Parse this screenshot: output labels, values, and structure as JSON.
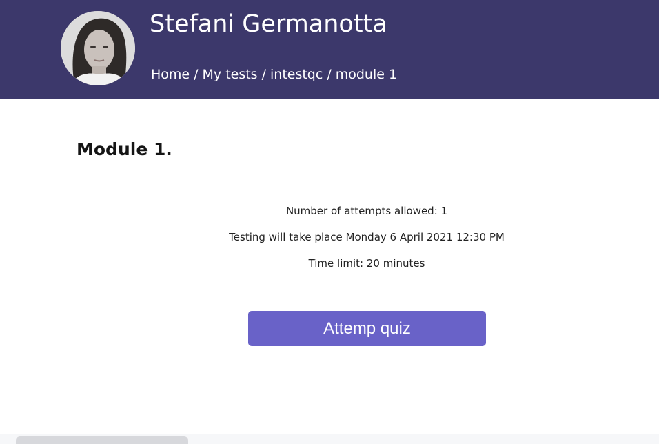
{
  "header": {
    "user_name": "Stefani Germanotta",
    "avatar_icon": "user-avatar-photo",
    "background_color": "#3c386b",
    "breadcrumb": {
      "home": "Home",
      "my_tests": "My tests",
      "course": "intestqc",
      "current": "module 1",
      "separator": "/"
    }
  },
  "main": {
    "title": "Module 1.",
    "attempts_text": "Number of attempts allowed: 1",
    "schedule_text": "Testing will take place Monday 6 April 2021 12:30 PM",
    "time_limit_text": "Time limit: 20 minutes",
    "button_label": "Attemp quiz",
    "button_color": "#6962c8"
  }
}
